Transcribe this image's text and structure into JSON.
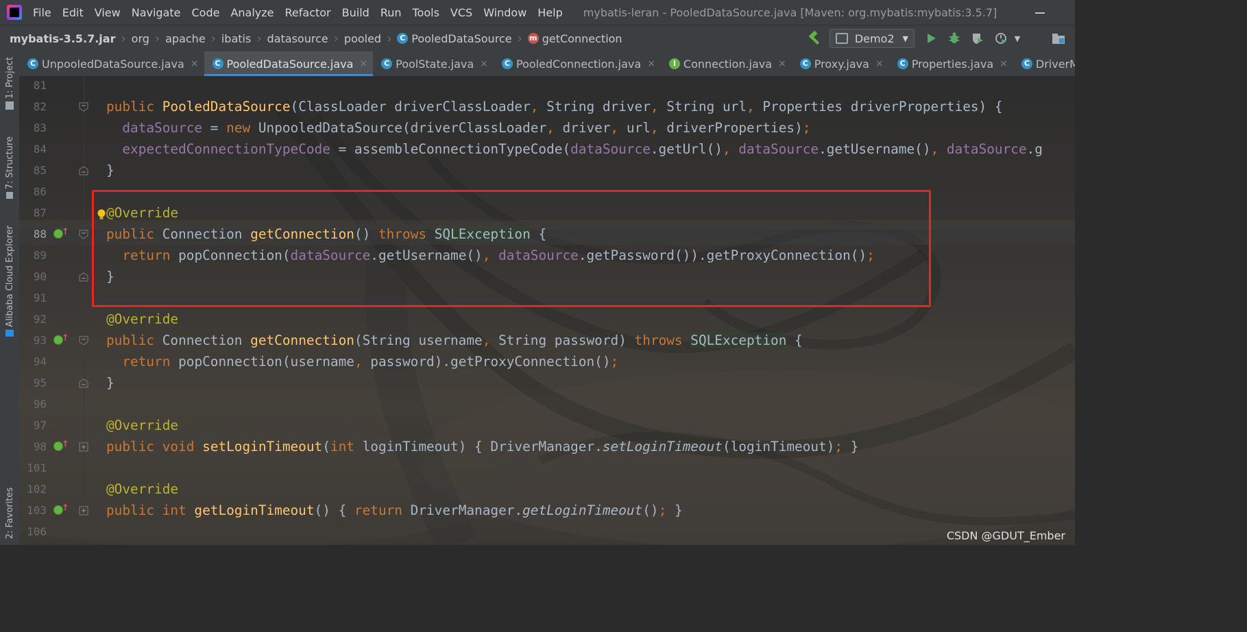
{
  "menu": {
    "items": [
      "File",
      "Edit",
      "View",
      "Navigate",
      "Code",
      "Analyze",
      "Refactor",
      "Build",
      "Run",
      "Tools",
      "VCS",
      "Window",
      "Help"
    ],
    "window_title": "mybatis-leran - PooledDataSource.java [Maven: org.mybatis:mybatis:3.5.7]"
  },
  "breadcrumb": {
    "items": [
      "mybatis-3.5.7.jar",
      "org",
      "apache",
      "ibatis",
      "datasource",
      "pooled",
      "PooledDataSource",
      "getConnection"
    ]
  },
  "toolbar": {
    "run_config": "Demo2"
  },
  "tabs": [
    {
      "label": "UnpooledDataSource.java",
      "icon": "class-icon"
    },
    {
      "label": "PooledDataSource.java",
      "icon": "class-icon",
      "active": true
    },
    {
      "label": "PoolState.java",
      "icon": "class-icon"
    },
    {
      "label": "PooledConnection.java",
      "icon": "class-icon"
    },
    {
      "label": "Connection.java",
      "icon": "interface-icon"
    },
    {
      "label": "Proxy.java",
      "icon": "class-icon"
    },
    {
      "label": "Properties.java",
      "icon": "class-icon"
    },
    {
      "label": "DriverManager.java",
      "icon": "class-icon"
    }
  ],
  "tool_windows": [
    "1: Project",
    "7: Structure",
    "Alibaba Cloud Explorer",
    "2: Favorites"
  ],
  "editor": {
    "current_line": "88",
    "lines": [
      {
        "num": "81",
        "tokens": []
      },
      {
        "num": "82",
        "tokens": [
          [
            "kw",
            "public "
          ],
          [
            "fn",
            "PooledDataSource"
          ],
          [
            "plain",
            "(ClassLoader driverClassLoader"
          ],
          [
            "kw",
            ", "
          ],
          [
            "plain",
            "String driver"
          ],
          [
            "kw",
            ", "
          ],
          [
            "plain",
            "String url"
          ],
          [
            "kw",
            ", "
          ],
          [
            "plain",
            "Properties driverProperties) {"
          ]
        ]
      },
      {
        "num": "83",
        "tokens": [
          [
            "plain",
            "  "
          ],
          [
            "fld",
            "dataSource"
          ],
          [
            "plain",
            " = "
          ],
          [
            "kw",
            "new "
          ],
          [
            "plain",
            "UnpooledDataSource(driverClassLoader"
          ],
          [
            "kw",
            ", "
          ],
          [
            "plain",
            "driver"
          ],
          [
            "kw",
            ", "
          ],
          [
            "plain",
            "url"
          ],
          [
            "kw",
            ", "
          ],
          [
            "plain",
            "driverProperties)"
          ],
          [
            "kw",
            ";"
          ]
        ]
      },
      {
        "num": "84",
        "tokens": [
          [
            "plain",
            "  "
          ],
          [
            "fld",
            "expectedConnectionTypeCode"
          ],
          [
            "plain",
            " = assembleConnectionTypeCode("
          ],
          [
            "fld",
            "dataSource"
          ],
          [
            "plain",
            ".getUrl()"
          ],
          [
            "kw",
            ", "
          ],
          [
            "fld",
            "dataSource"
          ],
          [
            "plain",
            ".getUsername()"
          ],
          [
            "kw",
            ", "
          ],
          [
            "fld",
            "dataSource"
          ],
          [
            "plain",
            ".g"
          ]
        ]
      },
      {
        "num": "85",
        "tokens": [
          [
            "plain",
            "}"
          ]
        ]
      },
      {
        "num": "86",
        "tokens": []
      },
      {
        "num": "87",
        "tokens": [
          [
            "ann",
            "@Override"
          ]
        ]
      },
      {
        "num": "88",
        "tokens": [
          [
            "kw",
            "public "
          ],
          [
            "plain",
            "Connection "
          ],
          [
            "fn",
            "getConnection"
          ],
          [
            "plain",
            "() "
          ],
          [
            "kw",
            "throws "
          ],
          [
            "exc",
            "SQLException"
          ],
          [
            "plain",
            " {"
          ]
        ]
      },
      {
        "num": "89",
        "tokens": [
          [
            "plain",
            "  "
          ],
          [
            "kw",
            "return "
          ],
          [
            "plain",
            "popConnection("
          ],
          [
            "fld",
            "dataSource"
          ],
          [
            "plain",
            ".getUsername()"
          ],
          [
            "kw",
            ", "
          ],
          [
            "fld",
            "dataSource"
          ],
          [
            "plain",
            ".getPassword()).getProxyConnection()"
          ],
          [
            "kw",
            ";"
          ]
        ]
      },
      {
        "num": "90",
        "tokens": [
          [
            "plain",
            "}"
          ]
        ]
      },
      {
        "num": "91",
        "tokens": []
      },
      {
        "num": "92",
        "tokens": [
          [
            "ann",
            "@Override"
          ]
        ]
      },
      {
        "num": "93",
        "tokens": [
          [
            "kw",
            "public "
          ],
          [
            "plain",
            "Connection "
          ],
          [
            "fn",
            "getConnection"
          ],
          [
            "plain",
            "(String username"
          ],
          [
            "kw",
            ", "
          ],
          [
            "plain",
            "String password) "
          ],
          [
            "kw",
            "throws "
          ],
          [
            "exc",
            "SQLException"
          ],
          [
            "plain",
            " {"
          ]
        ]
      },
      {
        "num": "94",
        "tokens": [
          [
            "plain",
            "  "
          ],
          [
            "kw",
            "return "
          ],
          [
            "plain",
            "popConnection(username"
          ],
          [
            "kw",
            ", "
          ],
          [
            "plain",
            "password).getProxyConnection()"
          ],
          [
            "kw",
            ";"
          ]
        ]
      },
      {
        "num": "95",
        "tokens": [
          [
            "plain",
            "}"
          ]
        ]
      },
      {
        "num": "96",
        "tokens": []
      },
      {
        "num": "97",
        "tokens": [
          [
            "ann",
            "@Override"
          ]
        ]
      },
      {
        "num": "98",
        "tokens": [
          [
            "kw",
            "public void "
          ],
          [
            "fn",
            "setLoginTimeout"
          ],
          [
            "plain",
            "("
          ],
          [
            "kw",
            "int "
          ],
          [
            "plain",
            "loginTimeout) { DriverManager."
          ],
          [
            "ital",
            "setLoginTimeout"
          ],
          [
            "plain",
            "(loginTimeout)"
          ],
          [
            "kw",
            "; "
          ],
          [
            "plain",
            "}"
          ]
        ]
      },
      {
        "num": "101",
        "tokens": []
      },
      {
        "num": "102",
        "tokens": [
          [
            "ann",
            "@Override"
          ]
        ]
      },
      {
        "num": "103",
        "tokens": [
          [
            "kw",
            "public int "
          ],
          [
            "fn",
            "getLoginTimeout"
          ],
          [
            "plain",
            "() { "
          ],
          [
            "kw",
            "return "
          ],
          [
            "plain",
            "DriverManager."
          ],
          [
            "ital",
            "getLoginTimeout"
          ],
          [
            "plain",
            "()"
          ],
          [
            "kw",
            "; "
          ],
          [
            "plain",
            "}"
          ]
        ]
      },
      {
        "num": "106",
        "tokens": []
      }
    ]
  },
  "watermark": "CSDN @GDUT_Ember",
  "colors": {
    "keyword": "#cc7832",
    "method": "#ffc66d",
    "field": "#9876aa",
    "annotation": "#bbb529",
    "highlight_box": "#e8261f"
  }
}
